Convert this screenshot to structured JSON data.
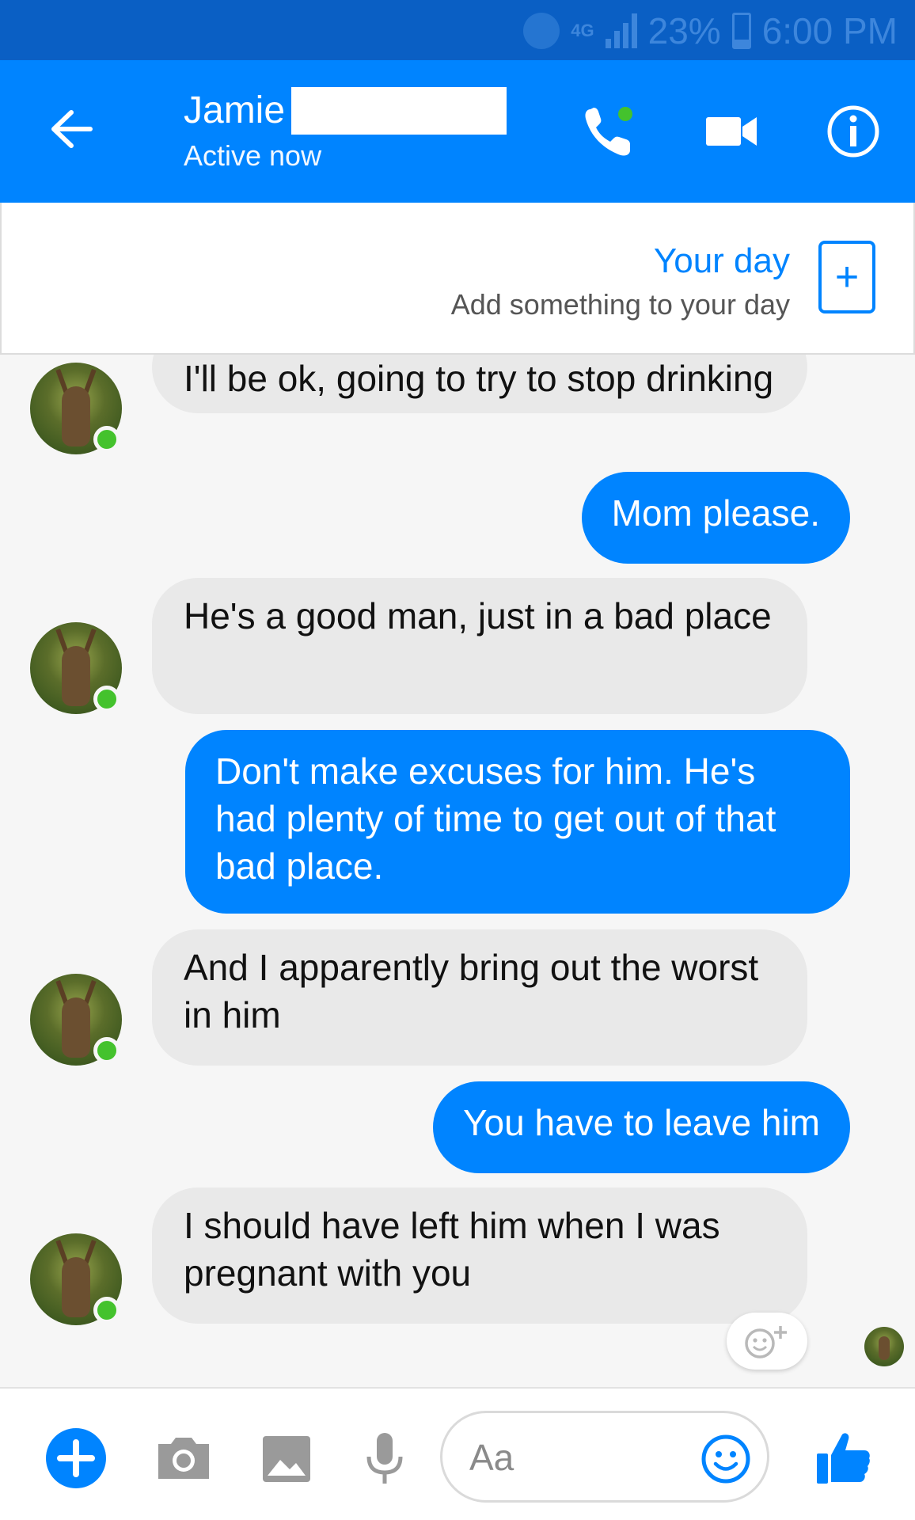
{
  "status_bar": {
    "network": "4G",
    "battery": "23%",
    "time": "6:00 PM"
  },
  "header": {
    "contact_name": "Jamie",
    "status": "Active now"
  },
  "your_day": {
    "title": "Your day",
    "subtitle": "Add something to your day",
    "add_symbol": "+"
  },
  "messages": [
    {
      "side": "in",
      "text": "I'll be ok, going to try to stop drinking"
    },
    {
      "side": "out",
      "text": "Mom please."
    },
    {
      "side": "in",
      "text": "He's a good man, just in a bad place"
    },
    {
      "side": "out",
      "text": "Don't make excuses for him. He's had plenty of time to get out of that bad place."
    },
    {
      "side": "in",
      "text": "And I apparently bring out the worst in him"
    },
    {
      "side": "out",
      "text": "You have to leave him"
    },
    {
      "side": "in",
      "text": "I should have left him when I was pregnant with you"
    }
  ],
  "composer": {
    "placeholder": "Aa"
  },
  "colors": {
    "header": "#0084ff",
    "status_bar": "#0a5fc4",
    "outgoing_bubble": "#0084ff",
    "incoming_bubble": "#e9e9e9",
    "online": "#44c22d"
  },
  "icons": [
    "back-arrow-icon",
    "phone-icon",
    "video-camera-icon",
    "info-icon",
    "plus-icon",
    "camera-icon",
    "image-icon",
    "microphone-icon",
    "emoji-icon",
    "thumbs-up-icon",
    "add-reaction-icon"
  ]
}
